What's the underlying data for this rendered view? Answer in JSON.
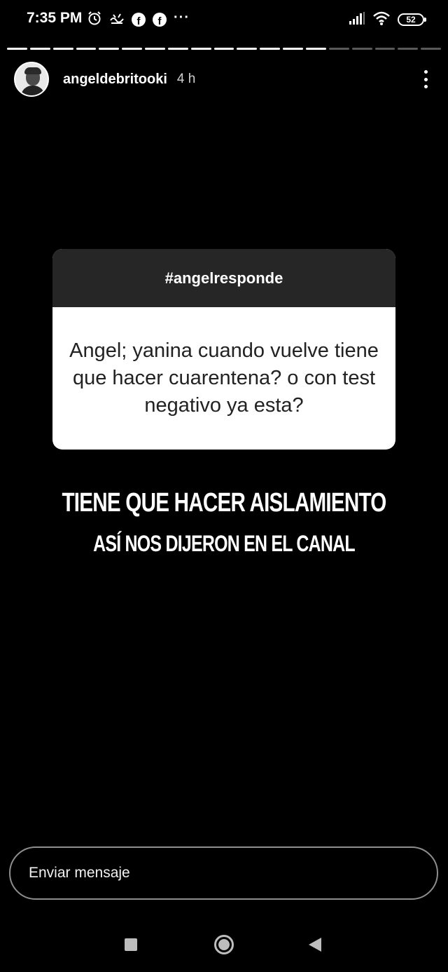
{
  "status_bar": {
    "time": "7:35 PM",
    "left_icons": [
      "alarm-icon",
      "vpn-key-icon",
      "facebook-icon",
      "facebook-icon",
      "more-notifications-icon"
    ],
    "right_icons": [
      "signal-icon",
      "wifi-icon",
      "battery-icon"
    ],
    "battery_level": "52"
  },
  "story": {
    "segments_total": 19,
    "segments_viewed": 14,
    "username": "angeldebritooki",
    "time_ago": "4 h"
  },
  "question_sticker": {
    "tag": "#angelresponde",
    "question": "Angel; yanina cuando vuelve tiene que hacer cuarentena? o con test negativo ya esta?"
  },
  "answer": {
    "line1": "TIENE QUE HACER AISLAMIENTO",
    "line2": "ASÍ NOS DIJERON EN EL CANAL"
  },
  "message_input": {
    "placeholder": "Enviar mensaje"
  },
  "nav_bar": {
    "buttons": [
      "recent-apps-icon",
      "home-icon",
      "back-icon"
    ]
  },
  "colors": {
    "background": "#000000",
    "card_header": "#262626",
    "card_body": "#ffffff",
    "input_border": "#8e8e8e"
  }
}
